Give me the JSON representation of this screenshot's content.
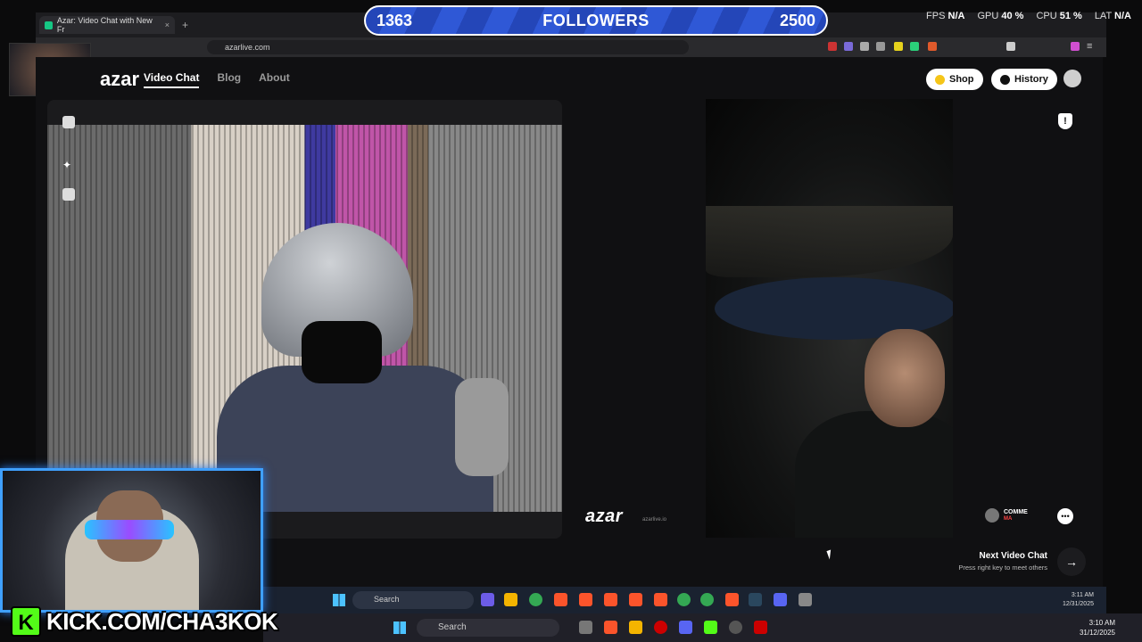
{
  "stream": {
    "followers_current": "1363",
    "followers_label": "FOLLOWERS",
    "followers_goal": "2500",
    "stats": [
      {
        "label": "FPS",
        "value": "N/A"
      },
      {
        "label": "GPU",
        "value": "40 %"
      },
      {
        "label": "CPU",
        "value": "51 %"
      },
      {
        "label": "LAT",
        "value": "N/A"
      }
    ],
    "kick_url": "KICK.COM/CHA3KOK",
    "kick_letter": "K"
  },
  "browser": {
    "tab_title": "Azar: Video Chat with New Fr",
    "tab_close": "×",
    "new_tab": "+",
    "url": "azarlive.com"
  },
  "app": {
    "logo": "azar",
    "nav": [
      "Video Chat",
      "Blog",
      "About"
    ],
    "shop_label": "Shop",
    "history_label": "History",
    "watermark": "azar",
    "watermark_sub": "azarlive.io",
    "peer_name": "COMME",
    "peer_country": "MA",
    "next_title": "Next Video Chat",
    "next_sub": "Press right key to meet others",
    "next_arrow": "→",
    "report_symbol": "!",
    "chat_symbol": "•••"
  },
  "taskbar_inner": {
    "search": "Search",
    "time": "3:11 AM",
    "date": "12/31/2025"
  },
  "taskbar_outer": {
    "search": "Search",
    "time": "3:10 AM",
    "date": "31/12/2025"
  },
  "colors": {
    "goal_blue": "#2446b8",
    "kick_green": "#53fc18",
    "cam_border": "#3fa0ff"
  }
}
